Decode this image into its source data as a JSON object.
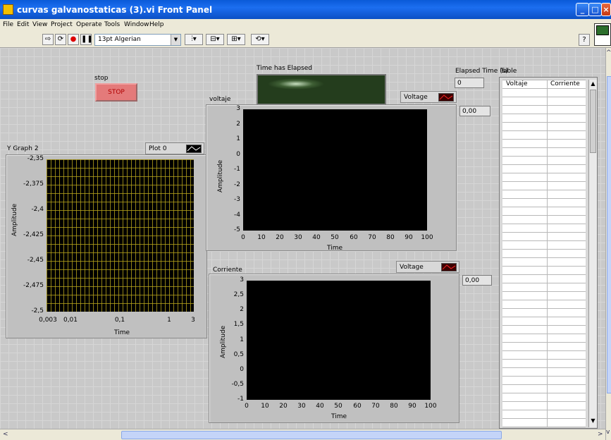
{
  "window": {
    "title": "curvas galvanostaticas (3).vi Front Panel"
  },
  "menu": [
    "File",
    "Edit",
    "View",
    "Project",
    "Operate",
    "Tools",
    "Window",
    "Help"
  ],
  "toolbar": {
    "font": "13pt Algerian"
  },
  "stop": {
    "label": "stop",
    "button": "STOP"
  },
  "timer": {
    "label": "Time has Elapsed"
  },
  "elapsed": {
    "label": "Elapsed Time (s)",
    "value": "0"
  },
  "table": {
    "label": "Table",
    "columns": [
      "Voltaje",
      "Corriente"
    ]
  },
  "graph_y": {
    "label": "Y Graph 2",
    "legend": "Plot 0",
    "ylabel": "Amplitude",
    "xlabel": "Time",
    "yticks": [
      "-2,35",
      "-2,375",
      "-2,4",
      "-2,425",
      "-2,45",
      "-2,475",
      "-2,5"
    ],
    "xticks": [
      "0,003",
      "0,01",
      "0,1",
      "1",
      "3"
    ]
  },
  "graph_voltaje": {
    "label": "voltaje",
    "legend": "Voltage",
    "ylabel": "Amplitude",
    "xlabel": "Time",
    "readout": "0,00",
    "yticks": [
      "3",
      "2",
      "1",
      "0",
      "-1",
      "-2",
      "-3",
      "-4",
      "-5"
    ],
    "xticks": [
      "0",
      "10",
      "20",
      "30",
      "40",
      "50",
      "60",
      "70",
      "80",
      "90",
      "100"
    ]
  },
  "graph_corriente": {
    "label": "Corriente",
    "legend": "Voltage",
    "ylabel": "Amplitude",
    "xlabel": "Time",
    "readout": "0,00",
    "yticks": [
      "3",
      "2,5",
      "2",
      "1,5",
      "1",
      "0,5",
      "0",
      "-0,5",
      "-1"
    ],
    "xticks": [
      "0",
      "10",
      "20",
      "30",
      "40",
      "50",
      "60",
      "70",
      "80",
      "90",
      "100"
    ]
  },
  "colors": {
    "titlebar": "#0a5ad8",
    "plot_bg": "#000000",
    "grid_yellow": "#b5a21c",
    "stop_red": "#e47a7a"
  }
}
